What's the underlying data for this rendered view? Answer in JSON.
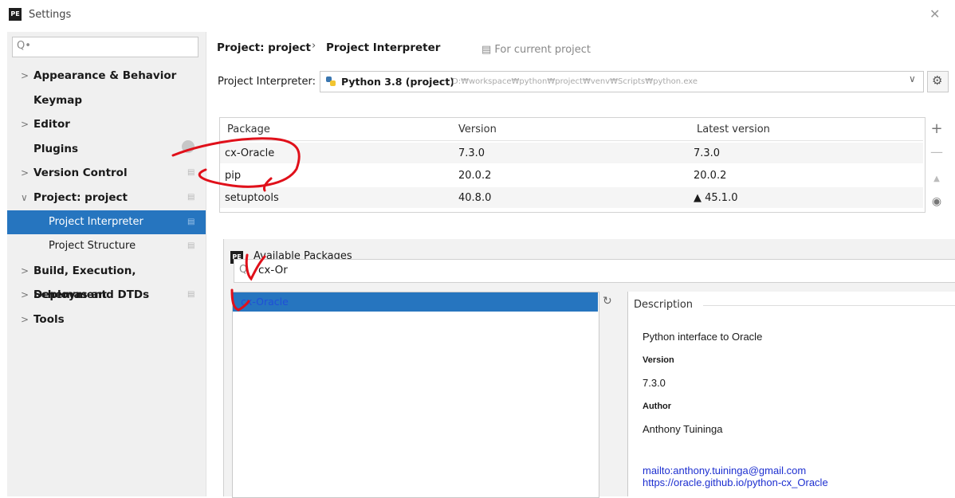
{
  "window": {
    "title": "Settings",
    "icon_label": "PE"
  },
  "sidebar": {
    "search_placeholder": "Q•",
    "items": [
      {
        "label": "Appearance & Behavior",
        "expandable": true
      },
      {
        "label": "Keymap",
        "expandable": false
      },
      {
        "label": "Editor",
        "expandable": true
      },
      {
        "label": "Plugins",
        "expandable": false
      },
      {
        "label": "Version Control",
        "expandable": true
      },
      {
        "label": "Project: project",
        "expanded": true
      },
      {
        "label": "Project Interpreter",
        "selected": true
      },
      {
        "label": "Project Structure"
      },
      {
        "label": "Build, Execution, Deployment",
        "expandable": true
      },
      {
        "label": "Schemas and DTDs",
        "expandable": true
      },
      {
        "label": "Tools",
        "expandable": true
      }
    ]
  },
  "breadcrumb": {
    "parent": "Project: project",
    "current": "Project Interpreter",
    "scope_note": "For current project"
  },
  "interpreter": {
    "label": "Project Interpreter:",
    "name": "Python 3.8 (project)",
    "path": "D:₩workspace₩python₩project₩venv₩Scripts₩python.exe"
  },
  "packages_table": {
    "headers": [
      "Package",
      "Version",
      "Latest version"
    ],
    "rows": [
      [
        "cx-Oracle",
        "7.3.0",
        "7.3.0"
      ],
      [
        "pip",
        "20.0.2",
        "20.0.2"
      ],
      [
        "setuptools",
        "40.8.0",
        "▲ 45.1.0"
      ]
    ]
  },
  "available_packages": {
    "title": "Available Packages",
    "search_value": "cx-Or",
    "results": [
      "cx-Oracle"
    ],
    "description": {
      "header": "Description",
      "summary": "Python interface to Oracle",
      "version_label": "Version",
      "version": "7.3.0",
      "author_label": "Author",
      "author": "Anthony Tuininga",
      "links": [
        "mailto:anthony.tuininga@gmail.com",
        "https://oracle.github.io/python-cx_Oracle"
      ]
    }
  },
  "colors": {
    "selection": "#2675bf",
    "link": "#1d2fd0",
    "annotation": "#e0101a"
  }
}
